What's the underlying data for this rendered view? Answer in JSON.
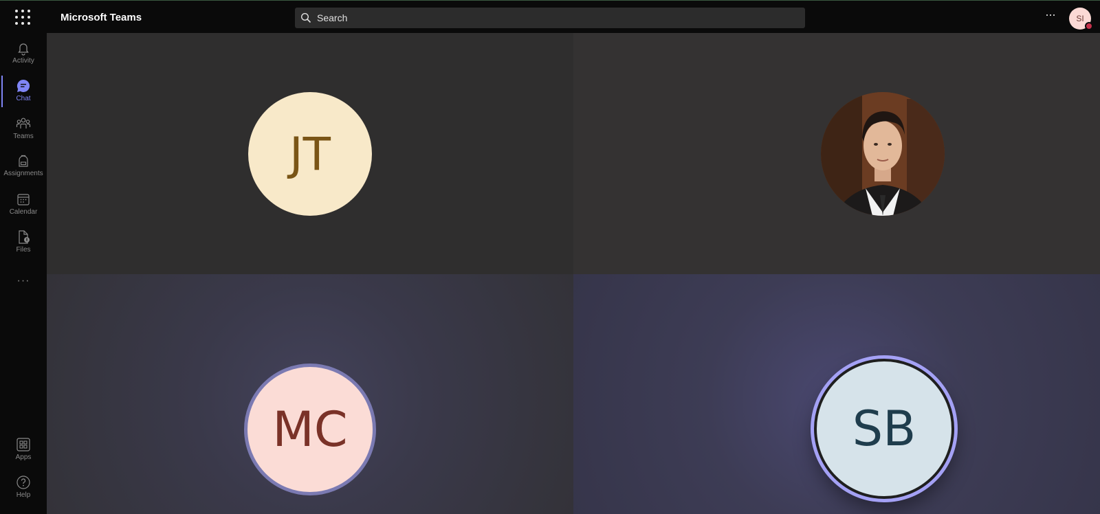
{
  "app": {
    "title": "Microsoft Teams"
  },
  "search": {
    "placeholder": "Search"
  },
  "user": {
    "initials": "SI",
    "status_color": "#c4314b"
  },
  "rail": {
    "items": [
      {
        "label": "Activity",
        "icon": "bell-icon"
      },
      {
        "label": "Chat",
        "icon": "chat-icon",
        "active": true
      },
      {
        "label": "Teams",
        "icon": "teams-icon"
      },
      {
        "label": "Assignments",
        "icon": "backpack-icon"
      },
      {
        "label": "Calendar",
        "icon": "calendar-icon"
      },
      {
        "label": "Files",
        "icon": "files-icon"
      }
    ],
    "more": "···",
    "bottom": [
      {
        "label": "Apps",
        "icon": "apps-icon"
      },
      {
        "label": "Help",
        "icon": "help-icon"
      }
    ]
  },
  "participants": [
    {
      "initials": "JT",
      "bg": "#f8e9c9",
      "fg": "#7a5516"
    },
    {
      "initials": "",
      "photo": true
    },
    {
      "initials": "MC",
      "bg": "#fbdcd6",
      "fg": "#7a3228",
      "speaking": true
    },
    {
      "initials": "SB",
      "bg": "#d6e3ea",
      "fg": "#1f3d4d",
      "speaking": true
    }
  ],
  "colors": {
    "accent": "#7f85f5",
    "ring": "#a4a1f5"
  }
}
